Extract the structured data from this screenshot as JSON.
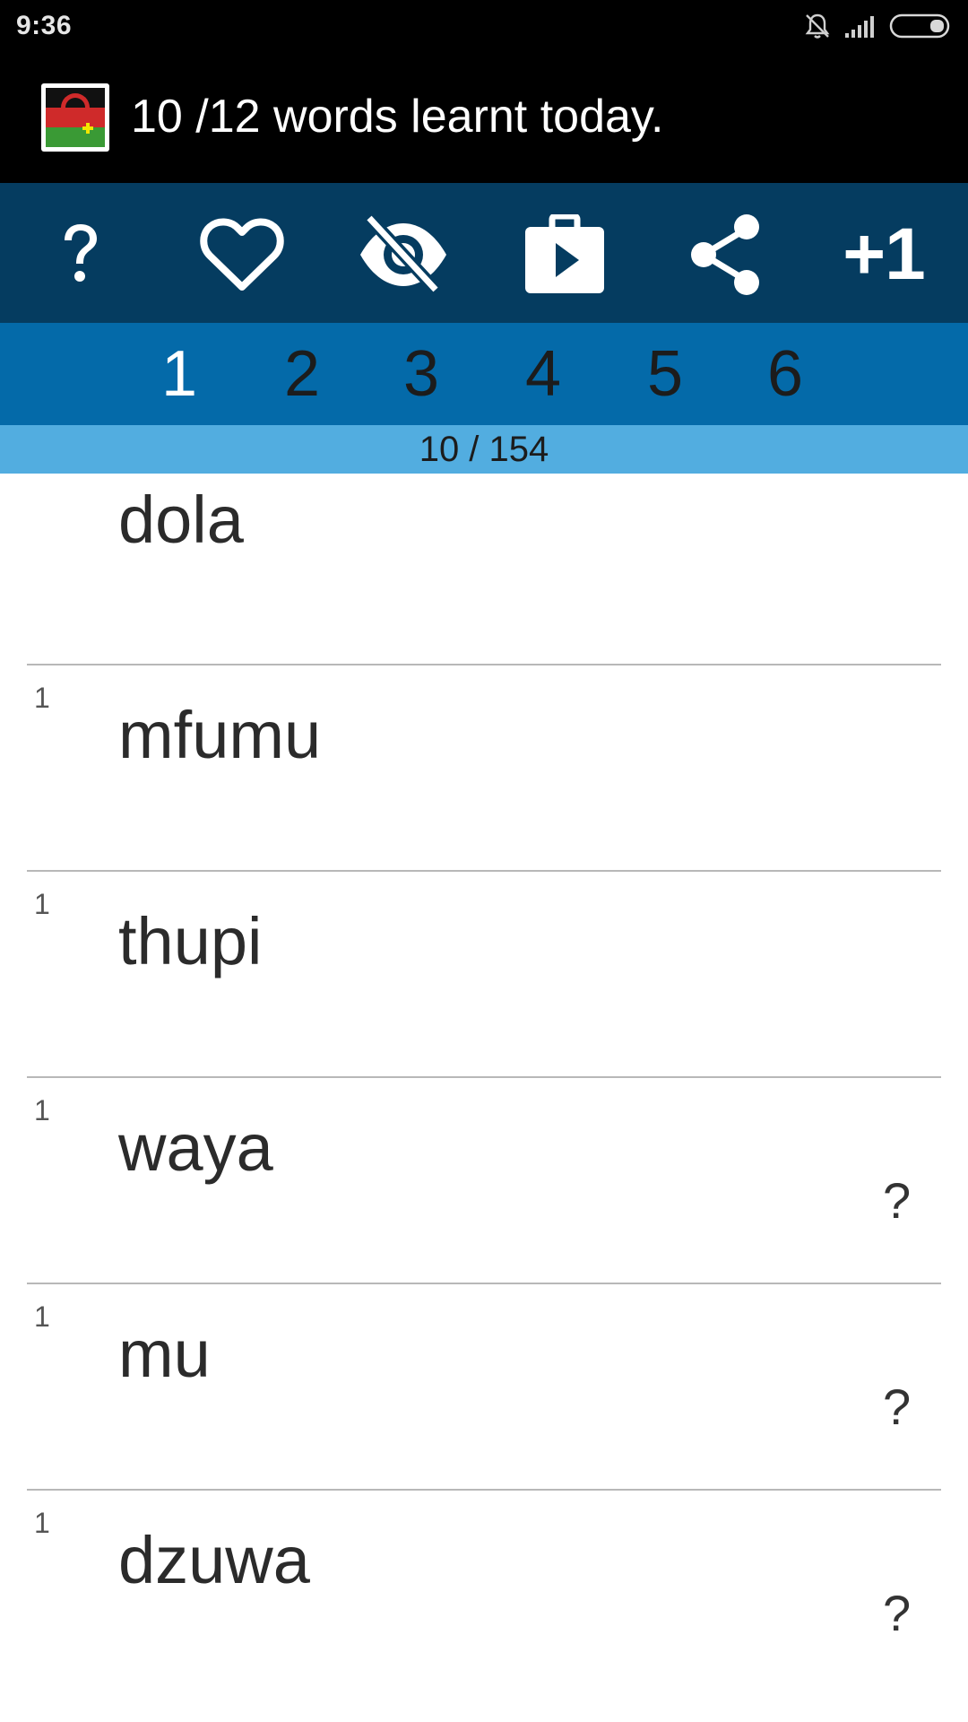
{
  "status_bar": {
    "time": "9:36",
    "icons": [
      "bell-muted-icon",
      "signal-icon",
      "battery-icon"
    ]
  },
  "header": {
    "logo": "malawi-flag-icon",
    "title": "10 /12 words learnt today."
  },
  "toolbar": {
    "buttons": [
      {
        "icon": "help-icon"
      },
      {
        "icon": "heart-icon"
      },
      {
        "icon": "visibility-off-icon"
      },
      {
        "icon": "play-store-icon"
      },
      {
        "icon": "share-icon"
      },
      {
        "label": "+1"
      }
    ]
  },
  "tabs": [
    "1",
    "2",
    "3",
    "4",
    "5",
    "6"
  ],
  "active_tab": "1",
  "progress": {
    "text": "10 / 154"
  },
  "words": [
    {
      "word": "dola",
      "count": "",
      "help": ""
    },
    {
      "word": "mfumu",
      "count": "1",
      "help": ""
    },
    {
      "word": "thupi",
      "count": "1",
      "help": ""
    },
    {
      "word": "waya",
      "count": "1",
      "help": "?"
    },
    {
      "word": "mu",
      "count": "1",
      "help": "?"
    },
    {
      "word": "dzuwa",
      "count": "1",
      "help": "?"
    }
  ],
  "colors": {
    "toolbar_bg": "#053c60",
    "tabs_bg": "#046aa9",
    "progress_bg": "#52ade0",
    "header_bg": "#000000"
  }
}
